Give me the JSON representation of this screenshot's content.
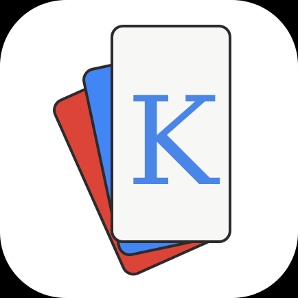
{
  "icon": {
    "letter": "K",
    "colors": {
      "background": "#ffffff",
      "corner_fill": "#000000",
      "back_card": "#db4437",
      "middle_card": "#4285f4",
      "front_card": "#f7f7f5",
      "letter": "#4a86e8",
      "outline": "#2b2b2b"
    },
    "cards": [
      "red-card",
      "blue-card",
      "white-card"
    ]
  }
}
